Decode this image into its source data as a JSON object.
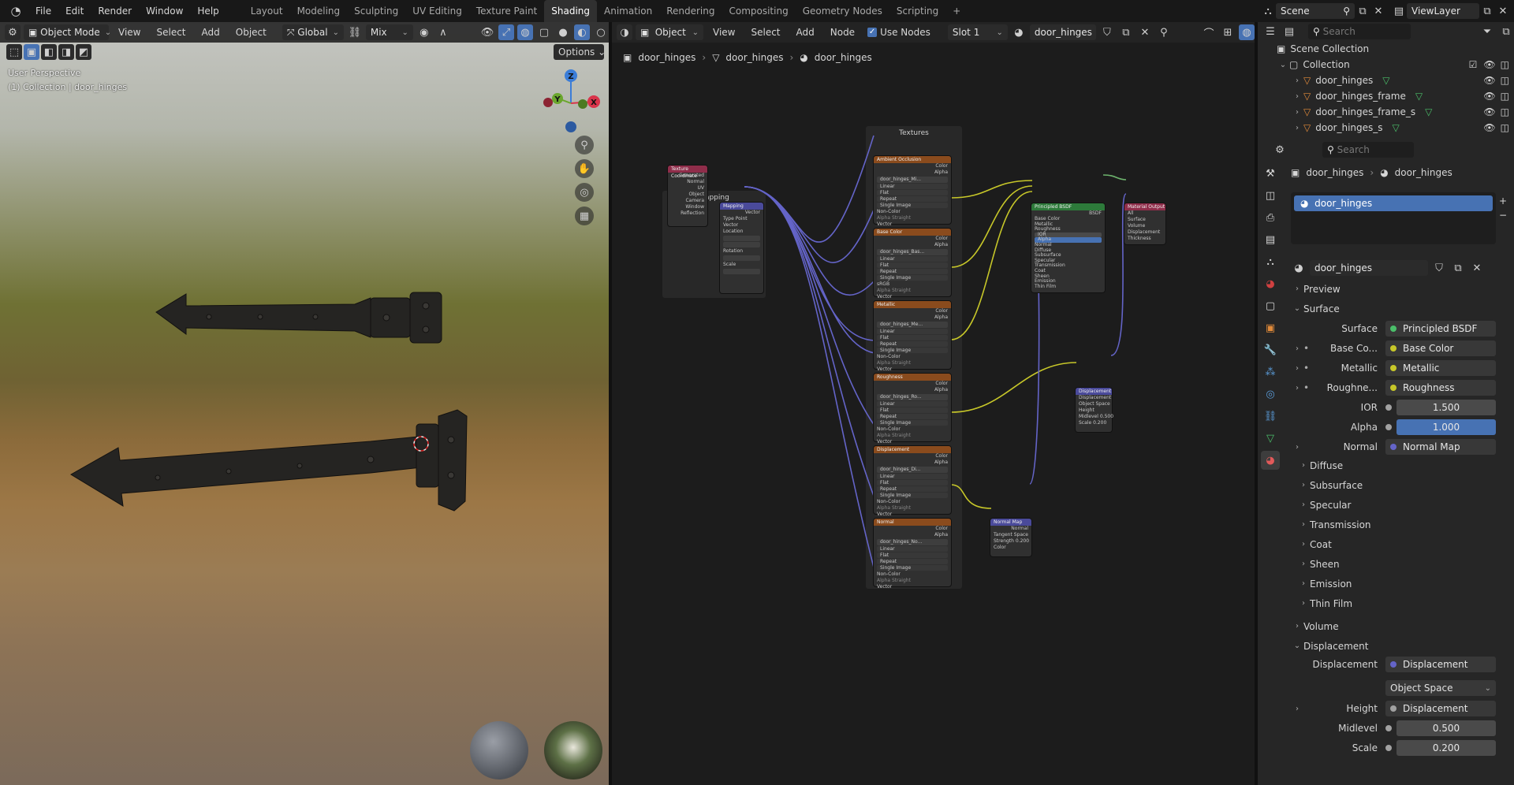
{
  "topbar": {
    "menus": [
      "File",
      "Edit",
      "Render",
      "Window",
      "Help"
    ],
    "workspaces": [
      "Layout",
      "Modeling",
      "Sculpting",
      "UV Editing",
      "Texture Paint",
      "Shading",
      "Animation",
      "Rendering",
      "Compositing",
      "Geometry Nodes",
      "Scripting"
    ],
    "active_workspace": "Shading",
    "add_tab": "+",
    "scene_label": "Scene",
    "view_layer_label": "ViewLayer"
  },
  "viewport": {
    "mode": "Object Mode",
    "menus": [
      "View",
      "Select",
      "Add",
      "Object"
    ],
    "orientation": "Global",
    "snap_mode": "Mix",
    "options_label": "Options",
    "overlay_title": "User Perspective",
    "overlay_collection": "(1) Collection | door_hinges",
    "gizmo_axes": {
      "z": "Z",
      "y": "Y",
      "x": "X"
    }
  },
  "node_editor": {
    "object_dropdown": "Object",
    "menus": [
      "View",
      "Select",
      "Add",
      "Node"
    ],
    "use_nodes_label": "Use Nodes",
    "use_nodes_checked": true,
    "slot": "Slot 1",
    "material_name": "door_hinges",
    "breadcrumb": [
      "door_hinges",
      "door_hinges",
      "door_hinges"
    ],
    "frames": {
      "mapping": "Mapping",
      "textures": "Textures"
    },
    "texture_nodes": [
      {
        "title": "Ambient Occlusion",
        "image": "door_hinges_Mi...",
        "color_space": "Non-Color"
      },
      {
        "title": "Base Color",
        "image": "door_hinges_Bas...",
        "color_space": "sRGB"
      },
      {
        "title": "Metallic",
        "image": "door_hinges_Me...",
        "color_space": "Non-Color"
      },
      {
        "title": "Roughness",
        "image": "door_hinges_Ro...",
        "color_space": "Non-Color"
      },
      {
        "title": "Displacement",
        "image": "door_hinges_Di...",
        "color_space": "Non-Color"
      },
      {
        "title": "Normal",
        "image": "door_hinges_No...",
        "color_space": "Non-Color"
      }
    ],
    "texture_rows": [
      "Linear",
      "Flat",
      "Repeat",
      "Single Image"
    ],
    "texture_sockets": {
      "color": "Color",
      "alpha": "Alpha",
      "vector": "Vector",
      "alpha_field": "Alpha",
      "straight": "Straight"
    },
    "texcoord": {
      "title": "Texture Coordinate",
      "outputs": [
        "Generated",
        "Normal",
        "UV",
        "Object",
        "Camera",
        "Window",
        "Reflection"
      ],
      "object_label": "Obje...",
      "from_instancer": "From Instancer"
    },
    "mapping": {
      "title": "Mapping",
      "vector_out": "Vector",
      "type_label": "Type",
      "type_value": "Point",
      "vector_in": "Vector",
      "location": "Location",
      "rotation": "Rotation",
      "scale": "Scale",
      "loc": [
        "0 m",
        "0 m",
        "0 m"
      ],
      "rot": [
        "0°",
        "0°",
        "0°"
      ],
      "scl": [
        "1.000",
        "1.000",
        "1.000"
      ],
      "axes": [
        "X",
        "Y",
        "Z"
      ]
    },
    "bsdf": {
      "title": "Principled BSDF",
      "out": "BSDF",
      "inputs": [
        "Base Color",
        "Metallic",
        "Roughness",
        "IOR",
        "Alpha",
        "Normal",
        "Diffuse",
        "Subsurface",
        "Specular",
        "Transmission",
        "Coat",
        "Sheen",
        "Emission",
        "Thin Film"
      ],
      "ior": "1.500",
      "alpha": "1.000"
    },
    "output": {
      "title": "Material Output",
      "target": "All",
      "inputs": [
        "Surface",
        "Volume",
        "Displacement",
        "Thickness"
      ]
    },
    "displacement": {
      "title": "Displacement",
      "out": "Displacement",
      "space": "Object Space",
      "height": "Height",
      "midlevel": "Midlevel",
      "midlevel_val": "0.500",
      "scale": "Scale",
      "scale_val": "0.200",
      "normal": "Normal"
    },
    "normal_map": {
      "title": "Normal Map",
      "out": "Normal",
      "space": "Tangent Space",
      "strength": "Strength",
      "strength_val": "0.200",
      "color": "Color"
    }
  },
  "outliner": {
    "search_placeholder": "Search",
    "scene_collection": "Scene Collection",
    "collection": "Collection",
    "items": [
      "door_hinges",
      "door_hinges_frame",
      "door_hinges_frame_s",
      "door_hinges_s"
    ]
  },
  "properties": {
    "search_placeholder": "Search",
    "breadcrumb": [
      "door_hinges",
      "door_hinges"
    ],
    "slot_item": "door_hinges",
    "material_name": "door_hinges",
    "preview": "Preview",
    "surface_panel": "Surface",
    "surface_label": "Surface",
    "surface_value": "Principled BSDF",
    "rows": [
      {
        "label": "Base Co...",
        "value": "Base Color",
        "socket": "#c7c729",
        "expand": true
      },
      {
        "label": "Metallic",
        "value": "Metallic",
        "socket": "#c7c729",
        "expand": true
      },
      {
        "label": "Roughne...",
        "value": "Roughness",
        "socket": "#c7c729",
        "expand": true
      }
    ],
    "ior_label": "IOR",
    "ior_value": "1.500",
    "alpha_label": "Alpha",
    "alpha_value": "1.000",
    "normal_label": "Normal",
    "normal_value": "Normal Map",
    "subpanels": [
      "Diffuse",
      "Subsurface",
      "Specular",
      "Transmission",
      "Coat",
      "Sheen",
      "Emission",
      "Thin Film"
    ],
    "volume_panel": "Volume",
    "displacement_panel": "Displacement",
    "displacement_label": "Displacement",
    "displacement_value": "Displacement",
    "space_value": "Object Space",
    "height_label": "Height",
    "height_value": "Displacement",
    "midlevel_label": "Midlevel",
    "midlevel_value": "0.500",
    "scale_label": "Scale",
    "scale_value": "0.200"
  },
  "colors": {
    "accent_blue": "#4772b3",
    "texture_header": "#8a4b1d",
    "shader_header": "#2d7a3a",
    "vector_header": "#4a4a9a",
    "input_header": "#8f2d4a",
    "output_header": "#8f2d4a",
    "link_yellow": "#c7c729",
    "link_purple": "#6464c8"
  }
}
